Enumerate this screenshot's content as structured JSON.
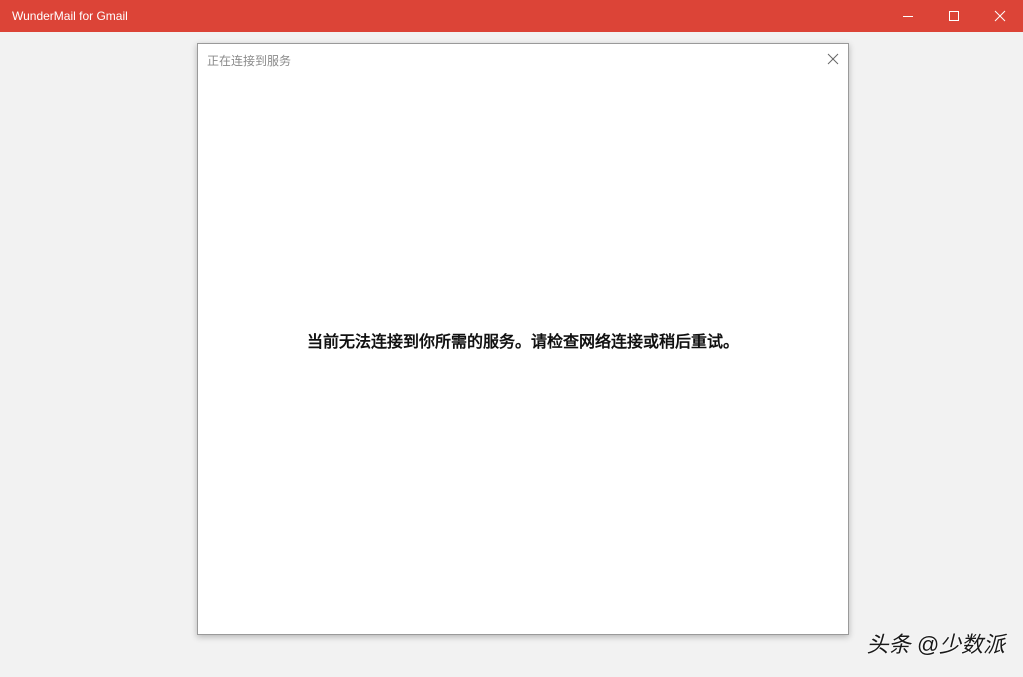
{
  "app": {
    "window_title": "WunderMail for Gmail",
    "accent_color": "#dc4437"
  },
  "window_controls": {
    "minimize_icon": "minimize-icon",
    "maximize_icon": "maximize-icon",
    "close_icon": "close-icon"
  },
  "dialog": {
    "title": "正在连接到服务",
    "message": "当前无法连接到你所需的服务。请检查网络连接或稍后重试。",
    "close_icon": "close-icon"
  },
  "watermark": {
    "text": "头条 @少数派"
  }
}
